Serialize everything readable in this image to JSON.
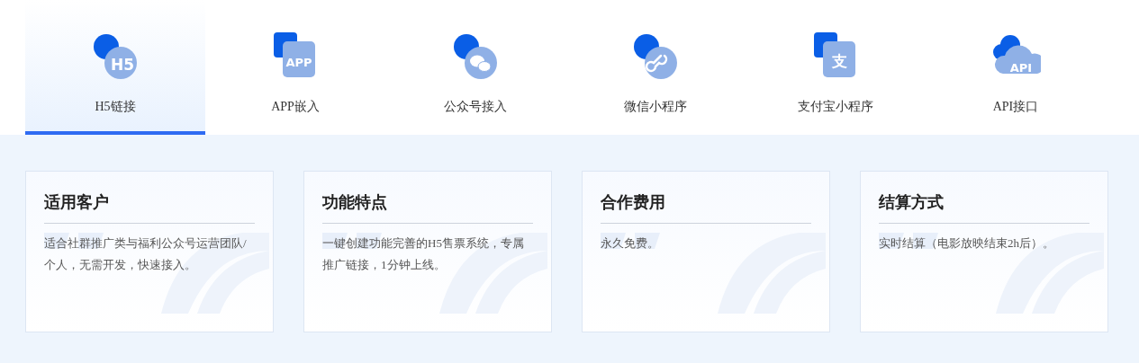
{
  "tabs": [
    {
      "label": "H5链接",
      "selected": true,
      "icon": {
        "kind": "circle",
        "text": "H5"
      }
    },
    {
      "label": "APP嵌入",
      "selected": false,
      "icon": {
        "kind": "square",
        "text": "APP"
      }
    },
    {
      "label": "公众号接入",
      "selected": false,
      "icon": {
        "kind": "chat"
      }
    },
    {
      "label": "微信小程序",
      "selected": false,
      "icon": {
        "kind": "link"
      }
    },
    {
      "label": "支付宝小程序",
      "selected": false,
      "icon": {
        "kind": "square",
        "text": "支"
      }
    },
    {
      "label": "API接口",
      "selected": false,
      "icon": {
        "kind": "cloud",
        "text": "API"
      }
    }
  ],
  "cards": [
    {
      "title": "适用客户",
      "text": "适合社群推广类与福利公众号运营团队/个人，无需开发，快速接入。"
    },
    {
      "title": "功能特点",
      "text": "一键创建功能完善的H5售票系统，专属推广链接，1分钟上线。"
    },
    {
      "title": "合作费用",
      "text": "永久免费。"
    },
    {
      "title": "结算方式",
      "text": "实时结算（电影放映结束2h后）。"
    }
  ]
}
